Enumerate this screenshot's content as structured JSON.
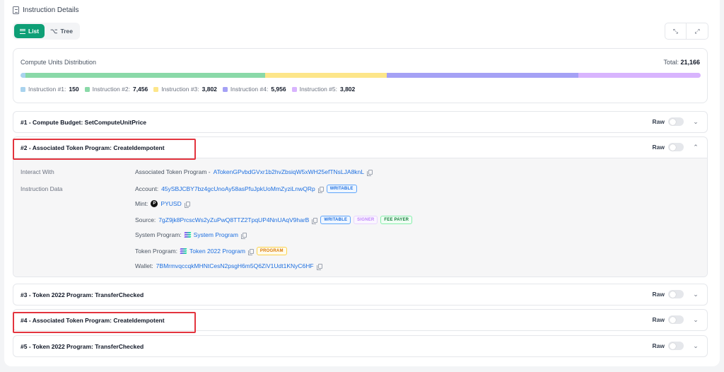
{
  "header": {
    "title": "Instruction Details"
  },
  "view_toggle": {
    "list_label": "List",
    "tree_label": "Tree"
  },
  "compute_units": {
    "title": "Compute Units Distribution",
    "total_label": "Total:",
    "total_value": "21,166",
    "segments": [
      {
        "name": "Instruction #1:",
        "value": "150",
        "units": 150,
        "color": "#a9d3ee"
      },
      {
        "name": "Instruction #2:",
        "value": "7,456",
        "units": 7456,
        "color": "#8ad9a8"
      },
      {
        "name": "Instruction #3:",
        "value": "3,802",
        "units": 3802,
        "color": "#fde68a"
      },
      {
        "name": "Instruction #4:",
        "value": "5,956",
        "units": 5956,
        "color": "#a5a1f5"
      },
      {
        "name": "Instruction #5:",
        "value": "3,802",
        "units": 3802,
        "color": "#d8b4fe"
      }
    ]
  },
  "raw_label": "Raw",
  "instructions": [
    {
      "title": "#1 - Compute Budget: SetComputeUnitPrice"
    },
    {
      "title": "#2 - Associated Token Program: CreateIdempotent"
    },
    {
      "title": "#3 - Token 2022 Program: TransferChecked"
    },
    {
      "title": "#4 - Associated Token Program: CreateIdempotent"
    },
    {
      "title": "#5 - Token 2022 Program: TransferChecked"
    }
  ],
  "details": {
    "interact_label": "Interact With",
    "interact_program": "Associated Token Program -",
    "interact_address": "ATokenGPvbdGVxr1b2hvZbsiqW5xWH25efTNsLJA8knL",
    "data_label": "Instruction Data",
    "account_label": "Account:",
    "account_value": "45ySBJCBY7bz4gcUnoAy58asPfuJpkUoMmZyziLnwQRp",
    "mint_label": "Mint:",
    "mint_value": "PYUSD",
    "source_label": "Source:",
    "source_value": "7gZ9jk8PrcscWs2yZuPwQ8TTZ2TpqUP4NnUAqV9harB",
    "system_label": "System Program:",
    "system_value": "System Program",
    "token_label": "Token Program:",
    "token_value": "Token 2022 Program",
    "wallet_label": "Wallet:",
    "wallet_value": "7BMrmvqccqkMHNtCesN2psgH6m5Q6ZiV1Udt1KNyC6HF",
    "badges": {
      "writable": "WRITABLE",
      "signer": "SIGNER",
      "fee_payer": "FEE PAYER",
      "program": "PROGRAM"
    }
  },
  "colors": {
    "accent": "#0e9f76",
    "link": "#1d6fe0",
    "highlight": "#e3343e"
  }
}
